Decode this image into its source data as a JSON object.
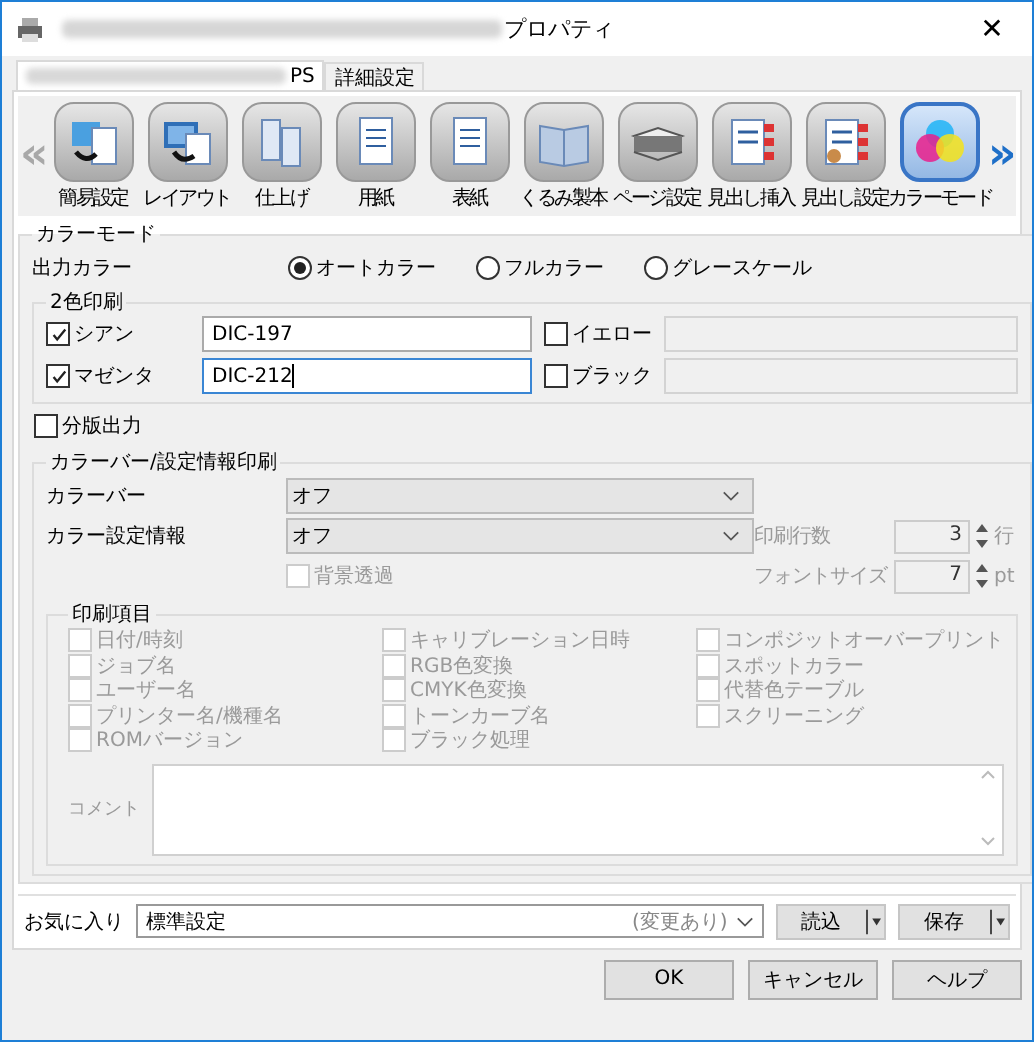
{
  "window": {
    "title": "プロパティ",
    "close": "✕"
  },
  "tabs": [
    {
      "label": "PS",
      "selected": true
    },
    {
      "label": "詳細設定",
      "selected": false
    }
  ],
  "toolbar": {
    "scroll_left": "«",
    "scroll_right": "»",
    "items": [
      {
        "label": "簡易設定",
        "kind": "pages",
        "selected": false
      },
      {
        "label": "レイアウト",
        "kind": "monitor",
        "selected": false
      },
      {
        "label": "仕上げ",
        "kind": "fold",
        "selected": false
      },
      {
        "label": "用紙",
        "kind": "document",
        "selected": false
      },
      {
        "label": "表紙",
        "kind": "cover",
        "selected": false
      },
      {
        "label": "くるみ製本",
        "kind": "book",
        "selected": false
      },
      {
        "label": "ページ設定",
        "kind": "stack",
        "selected": false
      },
      {
        "label": "見出し挿入",
        "kind": "tabs",
        "selected": false
      },
      {
        "label": "見出し設定",
        "kind": "tabs-tool",
        "selected": false
      },
      {
        "label": "カラーモード",
        "kind": "color",
        "selected": true
      }
    ]
  },
  "color_mode": {
    "legend": "カラーモード",
    "output_label": "出力カラー",
    "options": [
      {
        "label": "オートカラー",
        "selected": true
      },
      {
        "label": "フルカラー",
        "selected": false
      },
      {
        "label": "グレースケール",
        "selected": false
      }
    ]
  },
  "two_color": {
    "legend": "2色印刷",
    "inks": [
      {
        "label": "シアン",
        "checked": true,
        "value": "DIC-197",
        "focused": false,
        "disabled": false
      },
      {
        "label": "イエロー",
        "checked": false,
        "focused": false,
        "disabled": true
      },
      {
        "label": "マゼンタ",
        "checked": true,
        "value": "DIC-212",
        "focused": true,
        "disabled": false
      },
      {
        "label": "ブラック",
        "checked": false,
        "focused": false,
        "disabled": true
      }
    ]
  },
  "separation": {
    "label": "分版出力",
    "checked": false
  },
  "info_print": {
    "legend": "カラーバー/設定情報印刷",
    "rows": [
      {
        "label": "カラーバー",
        "value": "オフ"
      },
      {
        "label": "カラー設定情報",
        "value": "オフ"
      }
    ],
    "transparent": {
      "label": "背景透過",
      "checked": false,
      "disabled": true
    },
    "spinners": [
      {
        "label": "印刷行数",
        "value": "3",
        "unit": "行",
        "disabled": true
      },
      {
        "label": "フォントサイズ",
        "value": "7",
        "unit": "pt",
        "disabled": true
      }
    ]
  },
  "print_items": {
    "legend": "印刷項目",
    "items": [
      {
        "label": "日付/時刻",
        "checked": false,
        "disabled": true
      },
      {
        "label": "ジョブ名",
        "checked": false,
        "disabled": true
      },
      {
        "label": "ユーザー名",
        "checked": false,
        "disabled": true
      },
      {
        "label": "プリンター名/機種名",
        "checked": false,
        "disabled": true
      },
      {
        "label": "ROMバージョン",
        "checked": false,
        "disabled": true
      },
      {
        "label": "キャリブレーション日時",
        "checked": false,
        "disabled": true
      },
      {
        "label": "RGB色変換",
        "checked": false,
        "disabled": true
      },
      {
        "label": "CMYK色変換",
        "checked": false,
        "disabled": true
      },
      {
        "label": "トーンカーブ名",
        "checked": false,
        "disabled": true
      },
      {
        "label": "ブラック処理",
        "checked": false,
        "disabled": true
      },
      {
        "label": "コンポジットオーバープリント",
        "checked": false,
        "disabled": true
      },
      {
        "label": "スポットカラー",
        "checked": false,
        "disabled": true
      },
      {
        "label": "代替色テーブル",
        "checked": false,
        "disabled": true
      },
      {
        "label": "スクリーニング",
        "checked": false,
        "disabled": true
      }
    ],
    "comment": {
      "label": "コメント",
      "disabled": true
    }
  },
  "favorites": {
    "label": "お気に入り",
    "value": "標準設定",
    "note": "(変更あり)",
    "buttons": [
      "読込",
      "保存"
    ]
  },
  "buttons": [
    "OK",
    "キャンセル",
    "ヘルプ"
  ]
}
